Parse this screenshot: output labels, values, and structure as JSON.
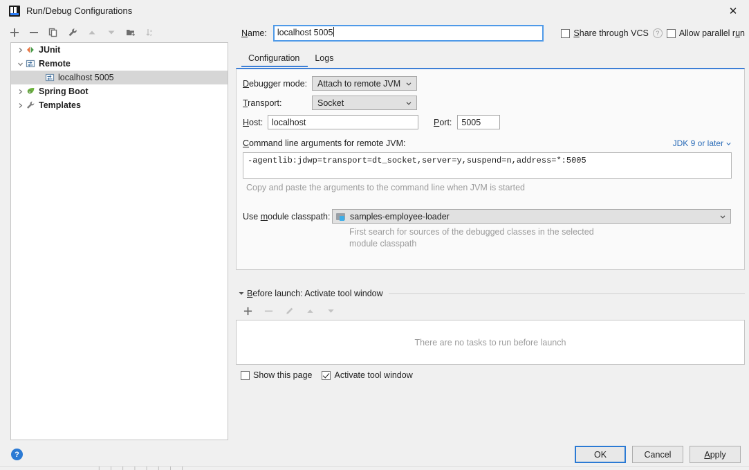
{
  "window": {
    "title": "Run/Debug Configurations",
    "logo_icon": "intellij-idea-logo",
    "close_icon": "close-icon"
  },
  "toolbar": {
    "buttons": [
      {
        "name": "add-configuration",
        "icon": "plus-icon",
        "enabled": true
      },
      {
        "name": "remove-configuration",
        "icon": "minus-icon",
        "enabled": true
      },
      {
        "name": "copy-configuration",
        "icon": "copy-icon",
        "enabled": true
      },
      {
        "name": "edit-templates",
        "icon": "wrench-icon",
        "enabled": true
      },
      {
        "name": "move-up",
        "icon": "triangle-up-icon",
        "enabled": false
      },
      {
        "name": "move-down",
        "icon": "triangle-down-icon",
        "enabled": false
      },
      {
        "name": "move-into-folder",
        "icon": "folder-add-icon",
        "enabled": true
      },
      {
        "name": "sort-configurations",
        "icon": "sort-az-icon",
        "enabled": false
      }
    ]
  },
  "tree": {
    "items": [
      {
        "label": "JUnit",
        "icon": "junit-icon",
        "expanded": false,
        "has_arrow": true,
        "depth": 0,
        "selected": false,
        "bold": true
      },
      {
        "label": "Remote",
        "icon": "remote-icon",
        "expanded": true,
        "has_arrow": true,
        "depth": 0,
        "selected": false,
        "bold": true
      },
      {
        "label": "localhost 5005",
        "icon": "remote-icon",
        "expanded": false,
        "has_arrow": false,
        "depth": 2,
        "selected": true,
        "bold": false
      },
      {
        "label": "Spring Boot",
        "icon": "spring-boot-icon",
        "expanded": false,
        "has_arrow": true,
        "depth": 0,
        "selected": false,
        "bold": true
      },
      {
        "label": "Templates",
        "icon": "wrench-icon",
        "expanded": false,
        "has_arrow": true,
        "depth": 0,
        "selected": false,
        "bold": true
      }
    ]
  },
  "name_row": {
    "label": "Name:",
    "value": "localhost 5005",
    "share_vcs_label": "Share through VCS",
    "share_vcs_checked": false,
    "help_icon": "question-mark-icon",
    "allow_parallel_label": "Allow parallel run",
    "allow_parallel_checked": false
  },
  "tabs": {
    "items": [
      {
        "label": "Configuration",
        "active": true
      },
      {
        "label": "Logs",
        "active": false
      }
    ]
  },
  "configuration": {
    "debugger_mode_label": "Debugger mode:",
    "debugger_mode_value": "Attach to remote JVM",
    "transport_label": "Transport:",
    "transport_value": "Socket",
    "host_label": "Host:",
    "host_value": "localhost",
    "port_label": "Port:",
    "port_value": "5005",
    "cmdline_label": "Command line arguments for remote JVM:",
    "jdk_link_label": "JDK 9 or later",
    "cmdline_value": "-agentlib:jdwp=transport=dt_socket,server=y,suspend=n,address=*:5005",
    "cmdline_hint": "Copy and paste the arguments to the command line when JVM is started",
    "module_classpath_label": "Use module classpath:",
    "module_classpath_value": "samples-employee-loader",
    "module_icon": "module-icon",
    "module_hint_line1": "First search for sources of the debugged classes in the selected",
    "module_hint_line2": "module classpath"
  },
  "before_launch": {
    "title": "Before launch: Activate tool window",
    "collapse_icon": "triangle-down-icon",
    "toolbar": [
      {
        "name": "add-task",
        "icon": "plus-icon",
        "enabled": true
      },
      {
        "name": "remove-task",
        "icon": "minus-icon",
        "enabled": false
      },
      {
        "name": "edit-task",
        "icon": "pencil-icon",
        "enabled": false
      },
      {
        "name": "move-task-up",
        "icon": "triangle-up-icon",
        "enabled": false
      },
      {
        "name": "move-task-down",
        "icon": "triangle-down-icon",
        "enabled": false
      }
    ],
    "empty_text": "There are no tasks to run before launch",
    "show_page_label": "Show this page",
    "show_page_checked": false,
    "activate_tool_window_label": "Activate tool window",
    "activate_tool_window_checked": true
  },
  "footer": {
    "help_icon": "help-circle-icon",
    "ok_label": "OK",
    "cancel_label": "Cancel",
    "apply_label": "Apply"
  },
  "colors": {
    "accent_blue": "#3d7fd6",
    "link_blue": "#2b6cb8",
    "selection_gray": "#d6d6d6",
    "dialog_bg": "#f0f0f0"
  }
}
